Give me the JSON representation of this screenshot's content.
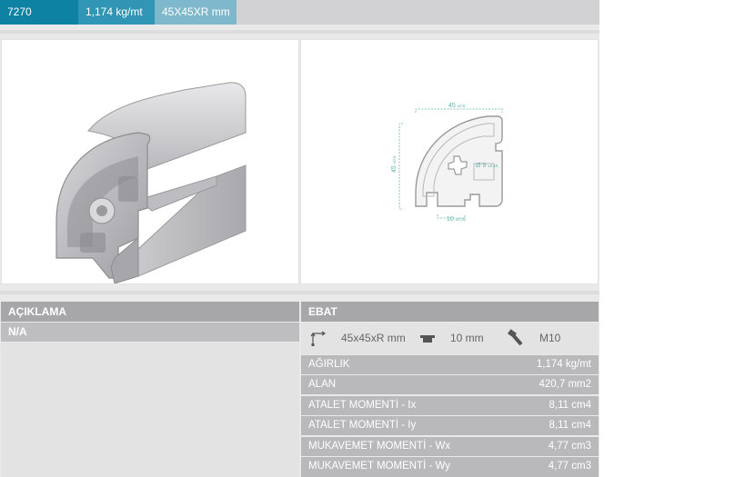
{
  "header": {
    "code": "7270",
    "weight": "1,174 kg/mt",
    "size": "45X45XR mm"
  },
  "drawing": {
    "width_dim": "45",
    "width_tol": "±0.5",
    "height_dim": "45",
    "height_tol": "±0.5",
    "hole_dim": "Ø 9",
    "hole_tol": "±0.15",
    "slot_dim": "10",
    "slot_tol": "±0.25"
  },
  "description": {
    "header": "AÇIKLAMA",
    "value": "N/A"
  },
  "specs": {
    "header": "EBAT",
    "dimension": "45x45xR mm",
    "slot": "10 mm",
    "bolt": "M10",
    "rows": [
      {
        "label": "AĞIRLIK",
        "value": "1,174 kg/mt"
      },
      {
        "label": "ALAN",
        "value": "420,7 mm2"
      },
      {
        "label": "ATALET MOMENTİ - Ix",
        "value": "8,11 cm4"
      },
      {
        "label": "ATALET MOMENTİ - Iy",
        "value": "8,11 cm4"
      },
      {
        "label": "MUKAVEMET MOMENTİ - Wx",
        "value": "4,77 cm3"
      },
      {
        "label": "MUKAVEMET MOMENTİ - Wy",
        "value": "4,77 cm3"
      }
    ]
  },
  "colors": {
    "code_bg": "#0d82a3",
    "weight_bg": "#3196b5",
    "size_bg": "#7fb8cc",
    "dimension_line": "#5fb5a8"
  }
}
